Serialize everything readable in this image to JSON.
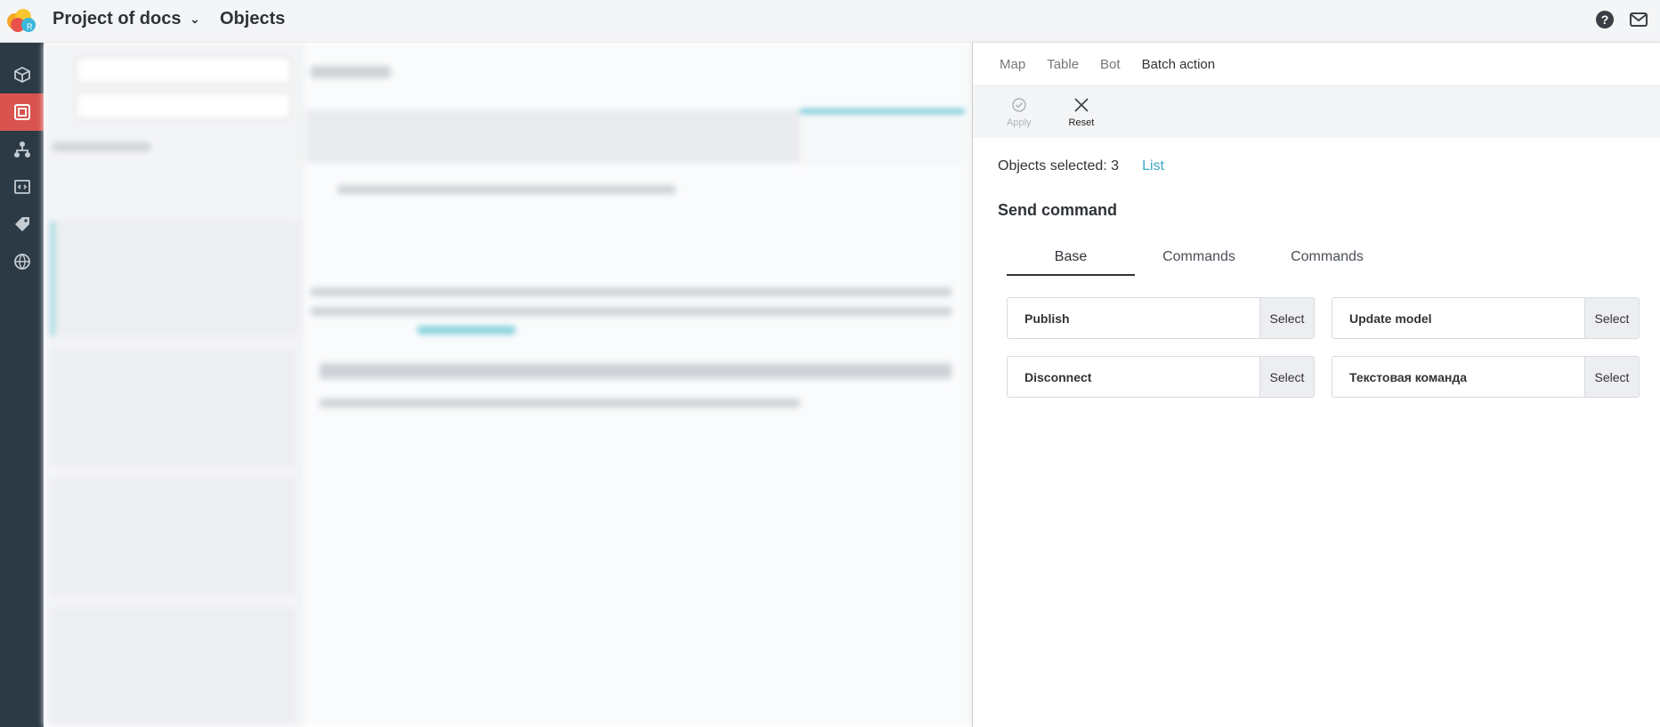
{
  "header": {
    "project_name": "Project of docs",
    "page_title": "Objects"
  },
  "sidebar": {
    "items": [
      {
        "icon": "cube-icon"
      },
      {
        "icon": "objects-icon",
        "active": true
      },
      {
        "icon": "hierarchy-icon"
      },
      {
        "icon": "code-icon"
      },
      {
        "icon": "tag-icon"
      },
      {
        "icon": "globe-icon"
      }
    ]
  },
  "panel": {
    "tabs": [
      "Map",
      "Table",
      "Bot",
      "Batch action"
    ],
    "active_tab": "Batch action",
    "toolbar": {
      "apply_label": "Apply",
      "reset_label": "Reset"
    },
    "objects_selected": "Objects selected: 3",
    "list_link": "List",
    "send_command_title": "Send command",
    "command_tabs": [
      "Base",
      "Commands",
      "Commands"
    ],
    "commands": [
      {
        "name": "Publish",
        "select": "Select"
      },
      {
        "name": "Update model",
        "select": "Select"
      },
      {
        "name": "Disconnect",
        "select": "Select"
      },
      {
        "name": "Текстовая команда",
        "select": "Select"
      }
    ]
  },
  "colors": {
    "sidebar_bg": "#2c3a45",
    "sidebar_active": "#d9534f",
    "link": "#3aa6c8"
  }
}
